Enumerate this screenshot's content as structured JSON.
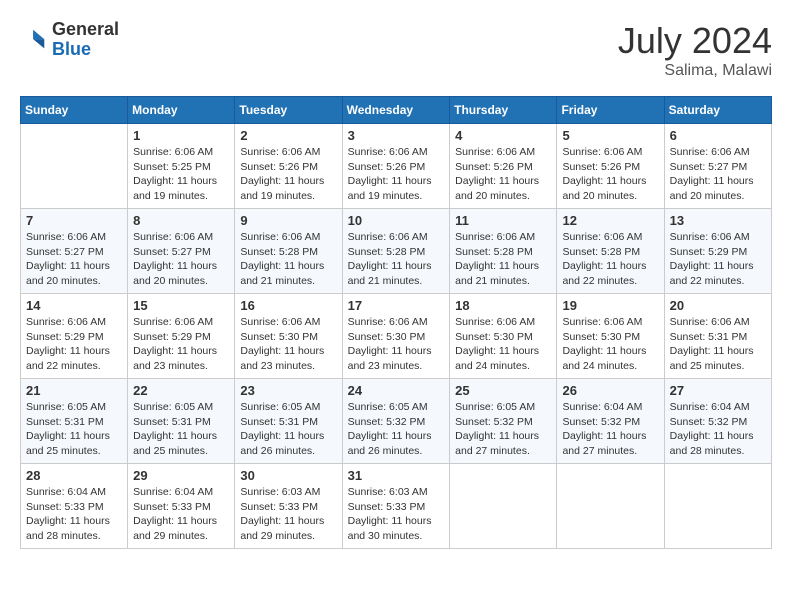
{
  "header": {
    "logo": {
      "general": "General",
      "blue": "Blue"
    },
    "title": "July 2024",
    "location": "Salima, Malawi"
  },
  "calendar": {
    "columns": [
      "Sunday",
      "Monday",
      "Tuesday",
      "Wednesday",
      "Thursday",
      "Friday",
      "Saturday"
    ],
    "weeks": [
      [
        {
          "day": "",
          "sunrise": "",
          "sunset": "",
          "daylight": ""
        },
        {
          "day": "1",
          "sunrise": "Sunrise: 6:06 AM",
          "sunset": "Sunset: 5:25 PM",
          "daylight": "Daylight: 11 hours and 19 minutes."
        },
        {
          "day": "2",
          "sunrise": "Sunrise: 6:06 AM",
          "sunset": "Sunset: 5:26 PM",
          "daylight": "Daylight: 11 hours and 19 minutes."
        },
        {
          "day": "3",
          "sunrise": "Sunrise: 6:06 AM",
          "sunset": "Sunset: 5:26 PM",
          "daylight": "Daylight: 11 hours and 19 minutes."
        },
        {
          "day": "4",
          "sunrise": "Sunrise: 6:06 AM",
          "sunset": "Sunset: 5:26 PM",
          "daylight": "Daylight: 11 hours and 20 minutes."
        },
        {
          "day": "5",
          "sunrise": "Sunrise: 6:06 AM",
          "sunset": "Sunset: 5:26 PM",
          "daylight": "Daylight: 11 hours and 20 minutes."
        },
        {
          "day": "6",
          "sunrise": "Sunrise: 6:06 AM",
          "sunset": "Sunset: 5:27 PM",
          "daylight": "Daylight: 11 hours and 20 minutes."
        }
      ],
      [
        {
          "day": "7",
          "sunrise": "Sunrise: 6:06 AM",
          "sunset": "Sunset: 5:27 PM",
          "daylight": "Daylight: 11 hours and 20 minutes."
        },
        {
          "day": "8",
          "sunrise": "Sunrise: 6:06 AM",
          "sunset": "Sunset: 5:27 PM",
          "daylight": "Daylight: 11 hours and 20 minutes."
        },
        {
          "day": "9",
          "sunrise": "Sunrise: 6:06 AM",
          "sunset": "Sunset: 5:28 PM",
          "daylight": "Daylight: 11 hours and 21 minutes."
        },
        {
          "day": "10",
          "sunrise": "Sunrise: 6:06 AM",
          "sunset": "Sunset: 5:28 PM",
          "daylight": "Daylight: 11 hours and 21 minutes."
        },
        {
          "day": "11",
          "sunrise": "Sunrise: 6:06 AM",
          "sunset": "Sunset: 5:28 PM",
          "daylight": "Daylight: 11 hours and 21 minutes."
        },
        {
          "day": "12",
          "sunrise": "Sunrise: 6:06 AM",
          "sunset": "Sunset: 5:28 PM",
          "daylight": "Daylight: 11 hours and 22 minutes."
        },
        {
          "day": "13",
          "sunrise": "Sunrise: 6:06 AM",
          "sunset": "Sunset: 5:29 PM",
          "daylight": "Daylight: 11 hours and 22 minutes."
        }
      ],
      [
        {
          "day": "14",
          "sunrise": "Sunrise: 6:06 AM",
          "sunset": "Sunset: 5:29 PM",
          "daylight": "Daylight: 11 hours and 22 minutes."
        },
        {
          "day": "15",
          "sunrise": "Sunrise: 6:06 AM",
          "sunset": "Sunset: 5:29 PM",
          "daylight": "Daylight: 11 hours and 23 minutes."
        },
        {
          "day": "16",
          "sunrise": "Sunrise: 6:06 AM",
          "sunset": "Sunset: 5:30 PM",
          "daylight": "Daylight: 11 hours and 23 minutes."
        },
        {
          "day": "17",
          "sunrise": "Sunrise: 6:06 AM",
          "sunset": "Sunset: 5:30 PM",
          "daylight": "Daylight: 11 hours and 23 minutes."
        },
        {
          "day": "18",
          "sunrise": "Sunrise: 6:06 AM",
          "sunset": "Sunset: 5:30 PM",
          "daylight": "Daylight: 11 hours and 24 minutes."
        },
        {
          "day": "19",
          "sunrise": "Sunrise: 6:06 AM",
          "sunset": "Sunset: 5:30 PM",
          "daylight": "Daylight: 11 hours and 24 minutes."
        },
        {
          "day": "20",
          "sunrise": "Sunrise: 6:06 AM",
          "sunset": "Sunset: 5:31 PM",
          "daylight": "Daylight: 11 hours and 25 minutes."
        }
      ],
      [
        {
          "day": "21",
          "sunrise": "Sunrise: 6:05 AM",
          "sunset": "Sunset: 5:31 PM",
          "daylight": "Daylight: 11 hours and 25 minutes."
        },
        {
          "day": "22",
          "sunrise": "Sunrise: 6:05 AM",
          "sunset": "Sunset: 5:31 PM",
          "daylight": "Daylight: 11 hours and 25 minutes."
        },
        {
          "day": "23",
          "sunrise": "Sunrise: 6:05 AM",
          "sunset": "Sunset: 5:31 PM",
          "daylight": "Daylight: 11 hours and 26 minutes."
        },
        {
          "day": "24",
          "sunrise": "Sunrise: 6:05 AM",
          "sunset": "Sunset: 5:32 PM",
          "daylight": "Daylight: 11 hours and 26 minutes."
        },
        {
          "day": "25",
          "sunrise": "Sunrise: 6:05 AM",
          "sunset": "Sunset: 5:32 PM",
          "daylight": "Daylight: 11 hours and 27 minutes."
        },
        {
          "day": "26",
          "sunrise": "Sunrise: 6:04 AM",
          "sunset": "Sunset: 5:32 PM",
          "daylight": "Daylight: 11 hours and 27 minutes."
        },
        {
          "day": "27",
          "sunrise": "Sunrise: 6:04 AM",
          "sunset": "Sunset: 5:32 PM",
          "daylight": "Daylight: 11 hours and 28 minutes."
        }
      ],
      [
        {
          "day": "28",
          "sunrise": "Sunrise: 6:04 AM",
          "sunset": "Sunset: 5:33 PM",
          "daylight": "Daylight: 11 hours and 28 minutes."
        },
        {
          "day": "29",
          "sunrise": "Sunrise: 6:04 AM",
          "sunset": "Sunset: 5:33 PM",
          "daylight": "Daylight: 11 hours and 29 minutes."
        },
        {
          "day": "30",
          "sunrise": "Sunrise: 6:03 AM",
          "sunset": "Sunset: 5:33 PM",
          "daylight": "Daylight: 11 hours and 29 minutes."
        },
        {
          "day": "31",
          "sunrise": "Sunrise: 6:03 AM",
          "sunset": "Sunset: 5:33 PM",
          "daylight": "Daylight: 11 hours and 30 minutes."
        },
        {
          "day": "",
          "sunrise": "",
          "sunset": "",
          "daylight": ""
        },
        {
          "day": "",
          "sunrise": "",
          "sunset": "",
          "daylight": ""
        },
        {
          "day": "",
          "sunrise": "",
          "sunset": "",
          "daylight": ""
        }
      ]
    ]
  }
}
